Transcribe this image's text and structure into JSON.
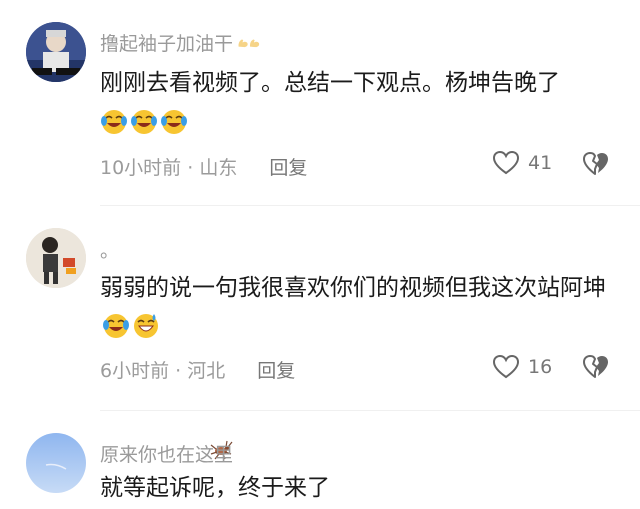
{
  "comments": [
    {
      "username": "撸起袖子加油干",
      "text": "刚刚去看视频了。总结一下观点。杨坤告晚了",
      "time": "10小时前",
      "location": "山东",
      "reply_label": "回复",
      "likes": "41",
      "emojis": [
        "laugh-cry",
        "laugh-cry",
        "laugh-cry"
      ]
    },
    {
      "username": "。",
      "text": "弱弱的说一句我很喜欢你们的视频但我这次站阿坤",
      "time": "6小时前",
      "location": "河北",
      "reply_label": "回复",
      "likes": "16",
      "emojis": [
        "laugh-cry",
        "grin-sweat"
      ]
    },
    {
      "username": "原来你也在这里",
      "text": "就等起诉呢，终于来了"
    }
  ],
  "meta_separator": "·",
  "colors": {
    "username": "#9a9a9a",
    "text": "#1b1b1b",
    "emoji_yellow": "#f7c531",
    "tear_blue": "#3a9ee6"
  }
}
